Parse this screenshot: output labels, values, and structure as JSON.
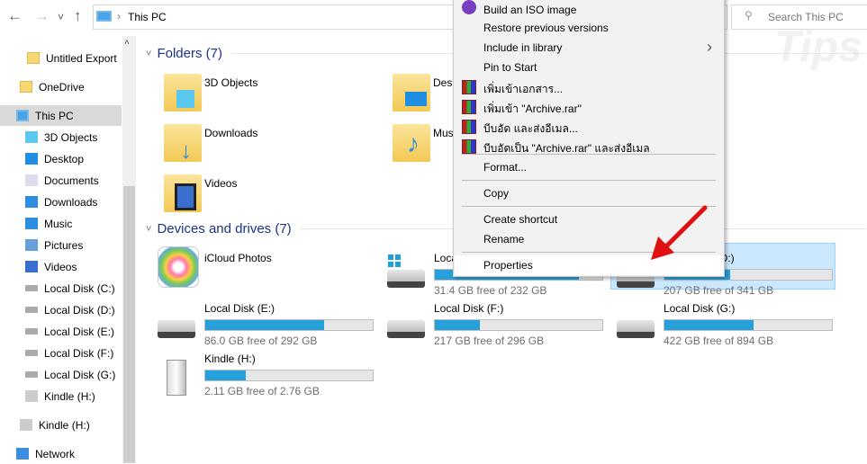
{
  "nav": {
    "back": "←",
    "forward": "→",
    "recent": "˅",
    "up": "↑"
  },
  "address": {
    "separator": "›",
    "location": "This PC"
  },
  "search": {
    "placeholder": "Search This PC"
  },
  "watermark": "Tips WARE",
  "sidebar": {
    "items": [
      {
        "label": "Untitled Export",
        "icon": "folder-icon"
      },
      {
        "label": "OneDrive",
        "icon": "folder-icon"
      },
      {
        "label": "This PC",
        "icon": "pc-icon",
        "selected": true
      },
      {
        "label": "3D Objects",
        "icon": "cube-icon"
      },
      {
        "label": "Desktop",
        "icon": "desktop-icon"
      },
      {
        "label": "Documents",
        "icon": "document-icon"
      },
      {
        "label": "Downloads",
        "icon": "download-icon"
      },
      {
        "label": "Music",
        "icon": "music-icon"
      },
      {
        "label": "Pictures",
        "icon": "pictures-icon"
      },
      {
        "label": "Videos",
        "icon": "videos-icon"
      },
      {
        "label": "Local Disk (C:)",
        "icon": "drive-icon"
      },
      {
        "label": "Local Disk (D:)",
        "icon": "drive-icon"
      },
      {
        "label": "Local Disk (E:)",
        "icon": "drive-icon"
      },
      {
        "label": "Local Disk (F:)",
        "icon": "drive-icon"
      },
      {
        "label": "Local Disk (G:)",
        "icon": "drive-icon"
      },
      {
        "label": "Kindle (H:)",
        "icon": "kindle-icon"
      },
      {
        "label": "Kindle (H:)",
        "icon": "kindle-icon"
      },
      {
        "label": "Network",
        "icon": "network-icon"
      }
    ]
  },
  "folders": {
    "header": "Folders (7)",
    "items": [
      "3D Objects",
      "Desktop",
      "Downloads",
      "Music",
      "Videos"
    ]
  },
  "devices": {
    "header": "Devices and drives (7)",
    "items": [
      {
        "name": "iCloud Photos"
      },
      {
        "name": "Local Disk (C:)",
        "free": "31.4 GB free of 232 GB",
        "used_pct": 86
      },
      {
        "name": "Local Disk (D:)",
        "free": "207 GB free of 341 GB",
        "used_pct": 39
      },
      {
        "name": "Local Disk (E:)",
        "free": "86.0 GB free of 292 GB",
        "used_pct": 71
      },
      {
        "name": "Local Disk (F:)",
        "free": "217 GB free of 296 GB",
        "used_pct": 27
      },
      {
        "name": "Local Disk (G:)",
        "free": "422 GB free of 894 GB",
        "used_pct": 53
      },
      {
        "name": "Kindle (H:)",
        "free": "2.11 GB free of 2.76 GB",
        "used_pct": 24
      }
    ]
  },
  "context_menu": {
    "items": [
      "Build an ISO image",
      "Restore previous versions",
      "Include in library",
      "Pin to Start",
      "เพิ่มเข้าเอกสาร...",
      "เพิ่มเข้า \"Archive.rar\"",
      "บีบอัด และส่งอีเมล...",
      "บีบอัดเป็น \"Archive.rar\" และส่งอีเมล",
      "Format...",
      "Copy",
      "Create shortcut",
      "Rename",
      "Properties"
    ],
    "submenu_arrow": "›"
  },
  "colors": {
    "accent": "#26a0da",
    "selection": "#cce8ff",
    "arrow": "#e01010"
  }
}
